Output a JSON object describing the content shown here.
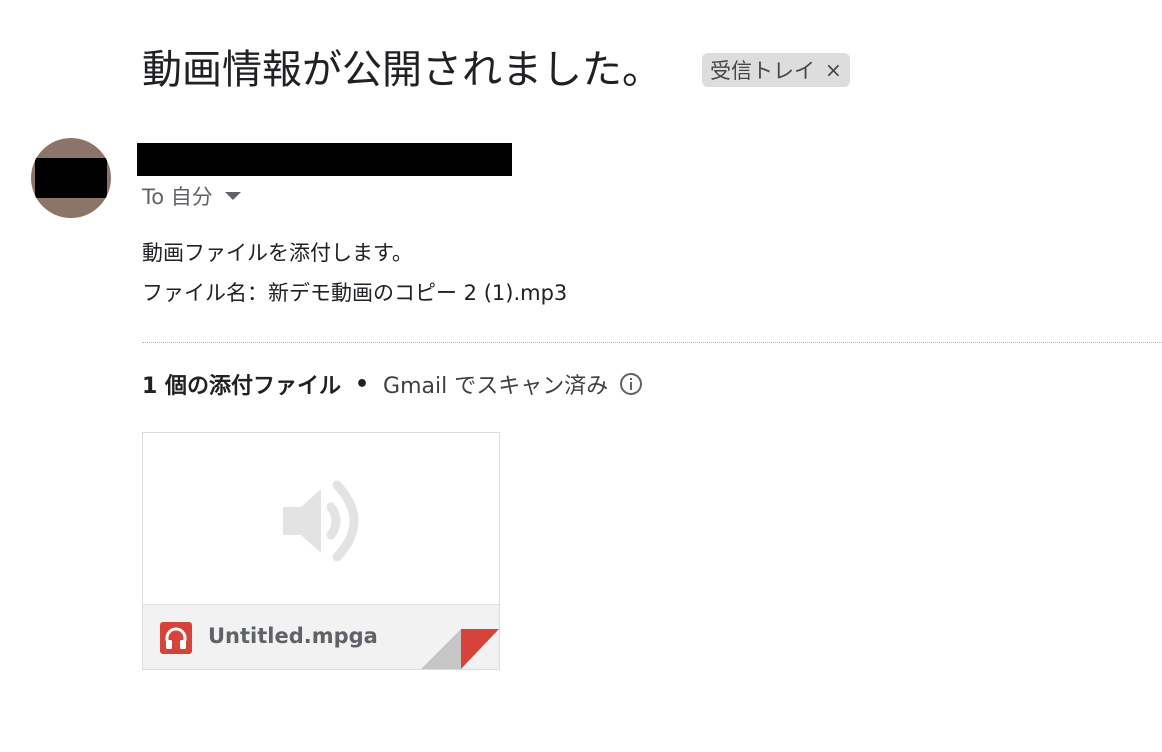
{
  "email": {
    "subject": "動画情報が公開されました。",
    "label_chip": "受信トレイ",
    "label_close_glyph": "×",
    "recipient": "To 自分",
    "body_lines": [
      "動画ファイルを添付します。",
      "ファイル名：新デモ動画のコピー 2 (1).mp3"
    ]
  },
  "attachments": {
    "count_label": "1 個の添付ファイル",
    "separator": "•",
    "scan_label": "Gmail でスキャン済み",
    "items": [
      {
        "file_name": "Untitled.mpga",
        "type_icon": "headphones-icon",
        "preview_icon": "speaker-icon"
      }
    ]
  },
  "colors": {
    "avatar_bg": "#8d7468",
    "file_icon_red": "#d5433a",
    "chip_bg": "#dddddd"
  }
}
